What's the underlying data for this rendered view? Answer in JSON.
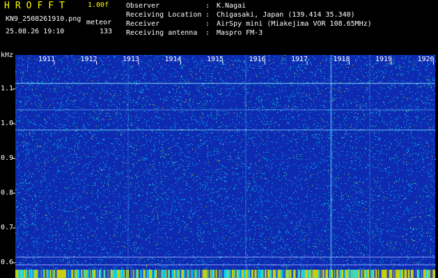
{
  "header": {
    "app_title": "HROFFT",
    "version": "1.00f",
    "filename": "KN9_2508261910.png",
    "meteor_label": "meteor",
    "datetime": "25.08.26 19:10",
    "meteor_count": "133"
  },
  "info": [
    {
      "label": "Observer",
      "value": "K.Nagai"
    },
    {
      "label": "Receiving Location",
      "value": "Chigasaki, Japan (139.414 35.340)"
    },
    {
      "label": "Receiver",
      "value": "AirSpy mini (Miakejima VOR 108.65MHz)"
    },
    {
      "label": "Receiving antenna",
      "value": "Maspro FM-3"
    }
  ],
  "axis": {
    "unit": "kHz",
    "freq_ticks": [
      "1.1",
      "1.0",
      "0.9",
      "0.8",
      "0.7",
      "0.6"
    ],
    "time_ticks": [
      "1911",
      "1912",
      "1913",
      "1914",
      "1915",
      "1916",
      "1917",
      "1918",
      "1919",
      "1920"
    ]
  },
  "colors": {
    "background": "#000000",
    "spectrogram_base": "#0d2ab0",
    "noise_cyan": "#00e0ff",
    "noise_yellow": "#ffff00",
    "title_yellow": "#ffff00"
  }
}
